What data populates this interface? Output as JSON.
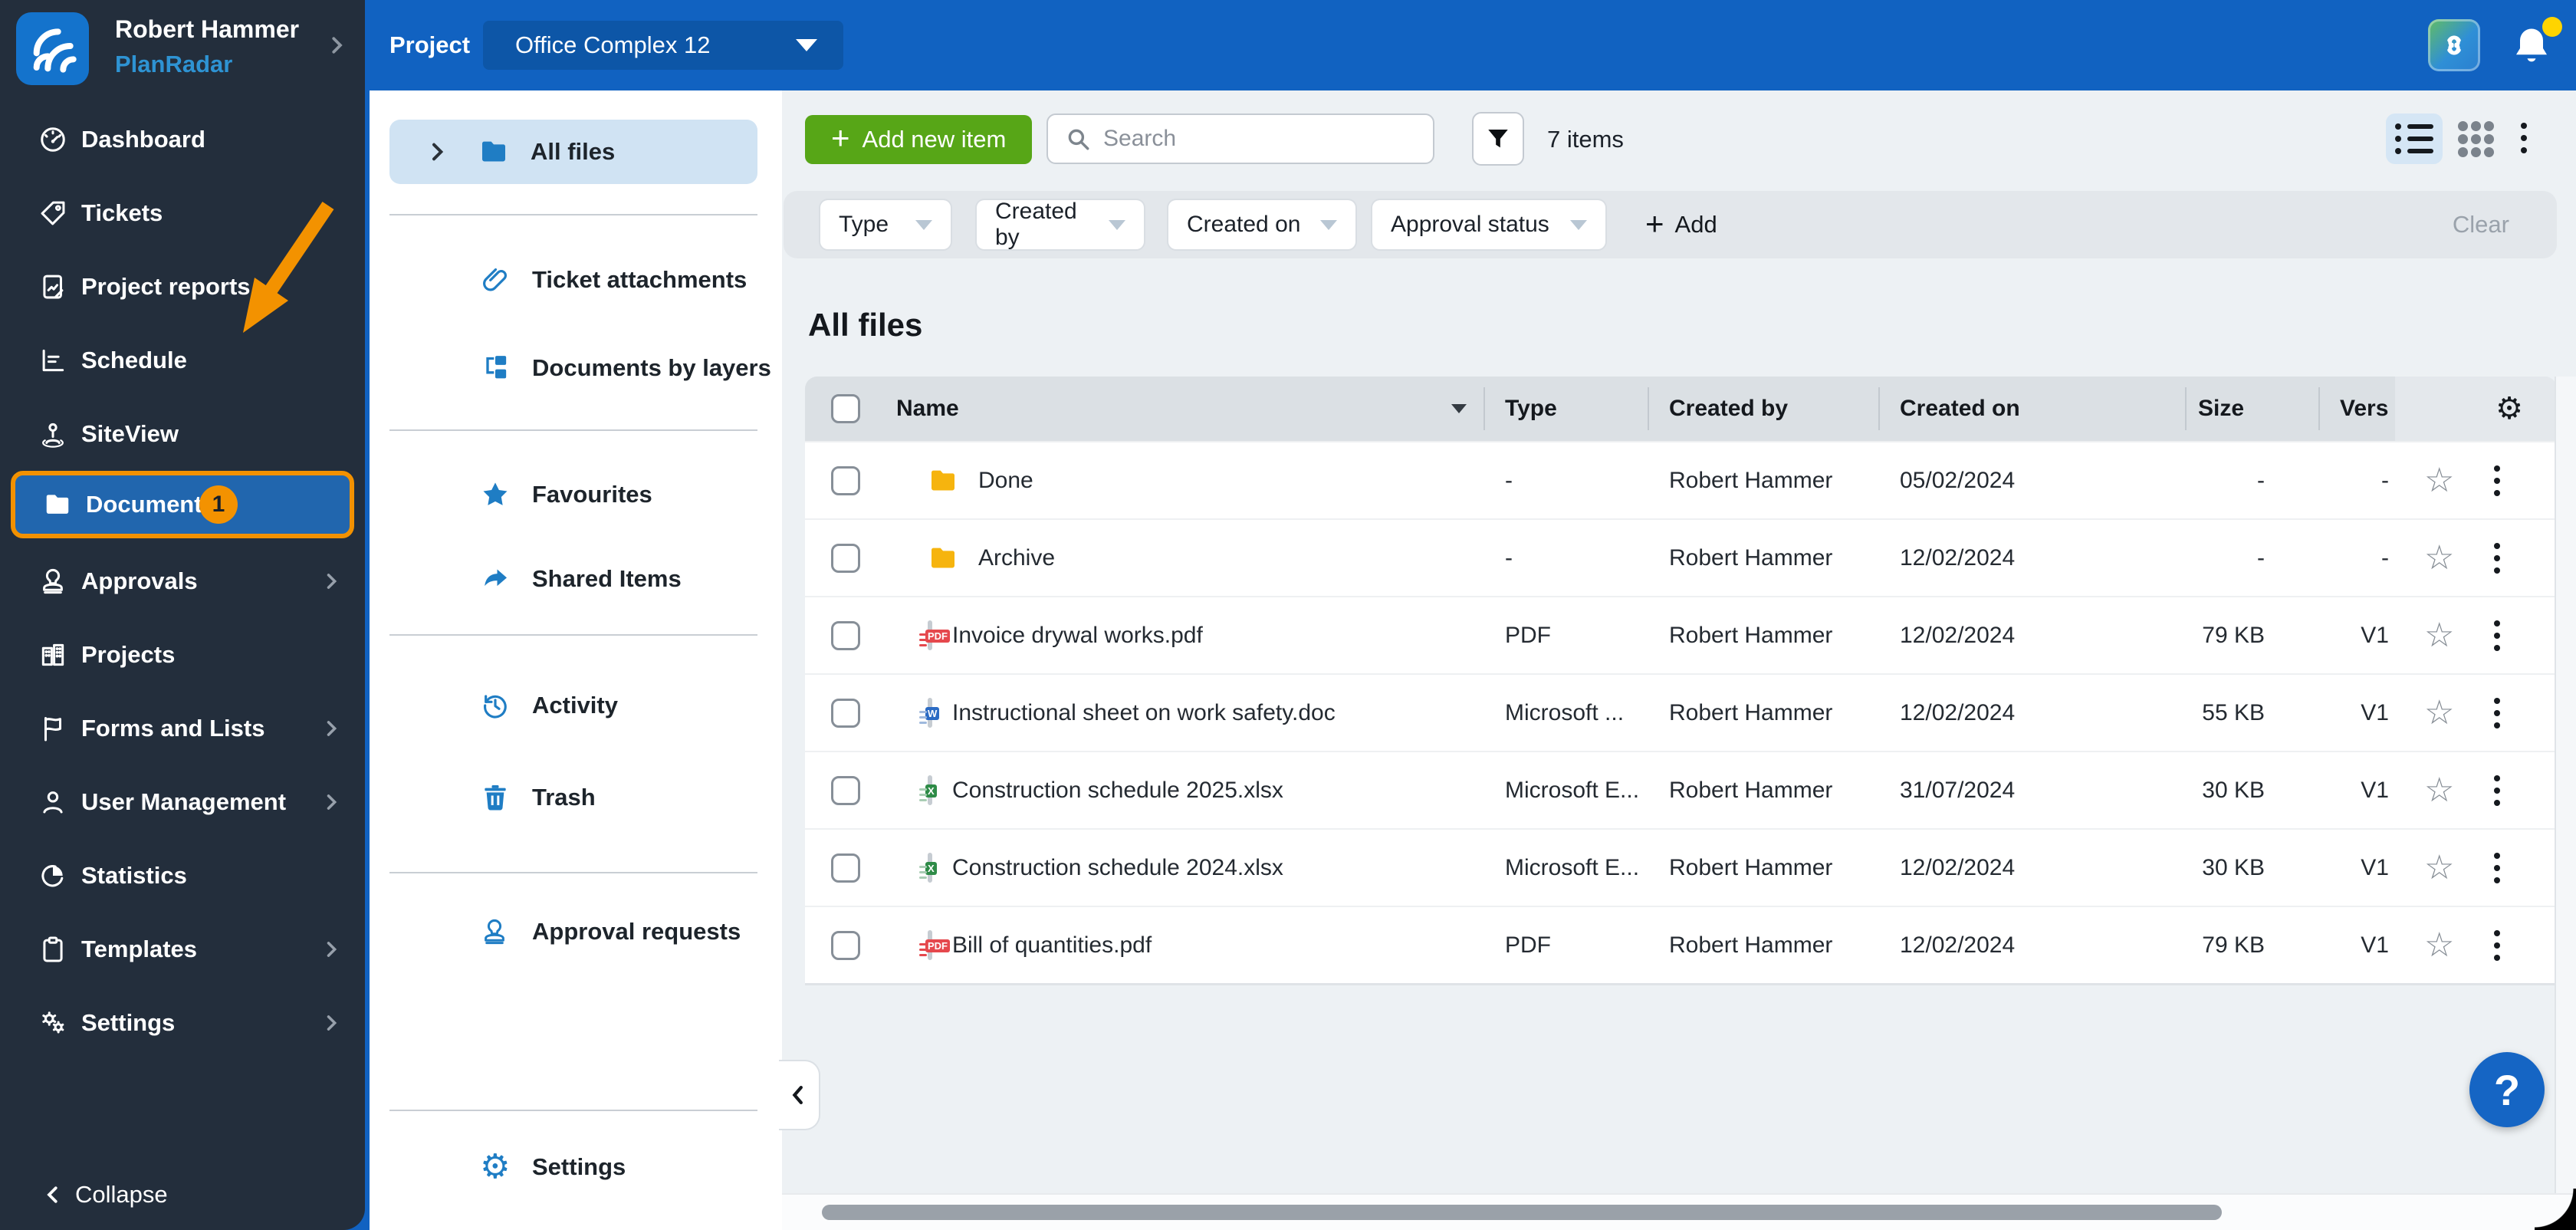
{
  "brand": {
    "user_name": "Robert Hammer",
    "app_name": "PlanRadar"
  },
  "topbar": {
    "project_label": "Project",
    "project_value": "Office Complex 12"
  },
  "sidebar": {
    "items": [
      {
        "label": "Dashboard",
        "icon": "gauge-icon"
      },
      {
        "label": "Tickets",
        "icon": "tag-icon"
      },
      {
        "label": "Project reports",
        "icon": "report-icon"
      },
      {
        "label": "Schedule",
        "icon": "schedule-icon"
      },
      {
        "label": "SiteView",
        "icon": "siteview-icon"
      },
      {
        "label": "Documents",
        "icon": "folder-icon",
        "active": true,
        "badge": "1"
      },
      {
        "label": "Approvals",
        "icon": "stamp-icon",
        "chevron": true
      },
      {
        "label": "Projects",
        "icon": "buildings-icon"
      },
      {
        "label": "Forms and Lists",
        "icon": "flag-icon",
        "chevron": true
      },
      {
        "label": "User Management",
        "icon": "user-icon",
        "chevron": true
      },
      {
        "label": "Statistics",
        "icon": "pie-icon"
      },
      {
        "label": "Templates",
        "icon": "clipboard-icon",
        "chevron": true
      },
      {
        "label": "Settings",
        "icon": "gears-icon",
        "chevron": true
      }
    ],
    "collapse_label": "Collapse"
  },
  "docnav": {
    "items": [
      {
        "label": "All files",
        "icon": "folder-open-icon",
        "active": true
      },
      {
        "label": "Ticket attachments",
        "icon": "paperclip-icon"
      },
      {
        "label": "Documents by layers",
        "icon": "layers-icon"
      },
      {
        "label": "Favourites",
        "icon": "star-icon"
      },
      {
        "label": "Shared Items",
        "icon": "share-icon"
      },
      {
        "label": "Activity",
        "icon": "history-icon"
      },
      {
        "label": "Trash",
        "icon": "trash-icon"
      },
      {
        "label": "Approval requests",
        "icon": "stamp-icon"
      },
      {
        "label": "Settings",
        "icon": "gear-icon"
      }
    ]
  },
  "toolbar": {
    "add_button": "Add new item",
    "search_placeholder": "Search",
    "items_count": "7 items"
  },
  "filters": {
    "chips": [
      "Type",
      "Created by",
      "Created on",
      "Approval status"
    ],
    "add_label": "Add",
    "clear_label": "Clear"
  },
  "content": {
    "title": "All files"
  },
  "table": {
    "columns": [
      "Name",
      "Type",
      "Created by",
      "Created on",
      "Size",
      "Vers"
    ],
    "rows": [
      {
        "name": "Done",
        "icon": "folder-icon",
        "type": "-",
        "created_by": "Robert Hammer",
        "created_on": "05/02/2024",
        "size": "-",
        "version": "-"
      },
      {
        "name": "Archive",
        "icon": "folder-icon",
        "type": "-",
        "created_by": "Robert Hammer",
        "created_on": "12/02/2024",
        "size": "-",
        "version": "-"
      },
      {
        "name": "Invoice drywal works.pdf",
        "icon": "pdf-file-icon",
        "type": "PDF",
        "created_by": "Robert Hammer",
        "created_on": "12/02/2024",
        "size": "79 KB",
        "version": "V1"
      },
      {
        "name": "Instructional sheet on work safety.doc",
        "icon": "word-file-icon",
        "type": "Microsoft ...",
        "created_by": "Robert Hammer",
        "created_on": "12/02/2024",
        "size": "55 KB",
        "version": "V1"
      },
      {
        "name": "Construction schedule 2025.xlsx",
        "icon": "excel-file-icon",
        "type": "Microsoft E...",
        "created_by": "Robert Hammer",
        "created_on": "31/07/2024",
        "size": "30 KB",
        "version": "V1"
      },
      {
        "name": "Construction schedule 2024.xlsx",
        "icon": "excel-file-icon",
        "type": "Microsoft E...",
        "created_by": "Robert Hammer",
        "created_on": "12/02/2024",
        "size": "30 KB",
        "version": "V1"
      },
      {
        "name": "Bill of quantities.pdf",
        "icon": "pdf-file-icon",
        "type": "PDF",
        "created_by": "Robert Hammer",
        "created_on": "12/02/2024",
        "size": "79 KB",
        "version": "V1"
      }
    ]
  },
  "help_label": "?",
  "colors": {
    "topbar_blue": "#1162C1",
    "sidebar_dark": "#232E3C",
    "selected_blue": "#2166AE",
    "annotation_orange": "#F39200",
    "button_green": "#57A617",
    "icon_blue": "#1F7DC4",
    "brand_light_blue": "#2E93D3",
    "folder_yellow": "#F6B40E",
    "help_blue": "#1565C4",
    "pdf_red": "#E5484D",
    "word_blue": "#2B6BC4",
    "excel_green": "#2E8B47"
  }
}
